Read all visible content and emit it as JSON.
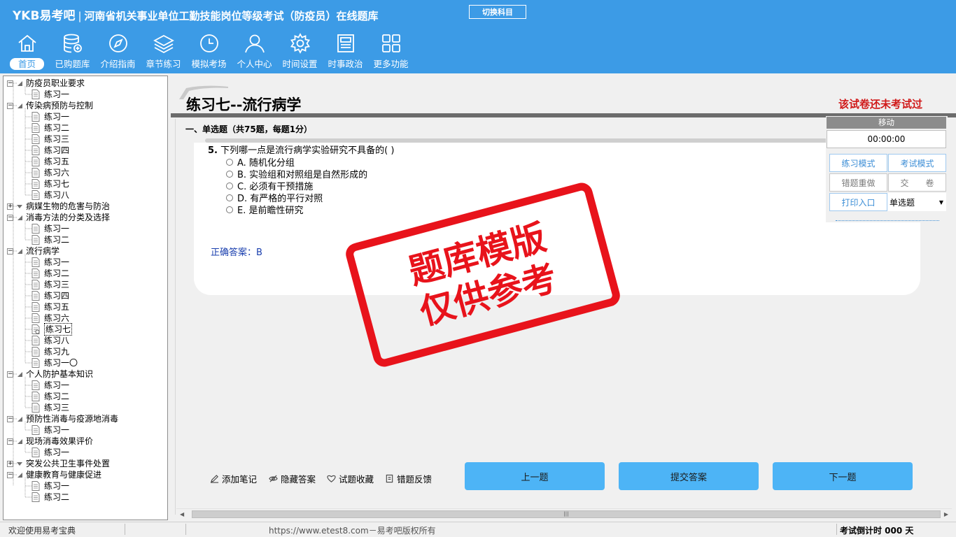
{
  "header": {
    "logo": "YKB易考吧",
    "separator": "|",
    "title": "河南省机关事业单位工勤技能岗位等级考试（防疫员）在线题库",
    "switch_label": "切换科目"
  },
  "nav": [
    {
      "label": "首页",
      "icon": "home-icon"
    },
    {
      "label": "已购题库",
      "icon": "database-icon"
    },
    {
      "label": "介绍指南",
      "icon": "compass-icon"
    },
    {
      "label": "章节练习",
      "icon": "layers-icon"
    },
    {
      "label": "模拟考场",
      "icon": "clock-icon"
    },
    {
      "label": "个人中心",
      "icon": "user-icon"
    },
    {
      "label": "时间设置",
      "icon": "gear-icon"
    },
    {
      "label": "时事政治",
      "icon": "news-icon"
    },
    {
      "label": "更多功能",
      "icon": "grid-icon"
    }
  ],
  "tree": [
    {
      "label": "防疫员职业要求",
      "level": 0,
      "expanded": true
    },
    {
      "label": "练习一",
      "level": 1
    },
    {
      "label": "传染病预防与控制",
      "level": 0,
      "expanded": true
    },
    {
      "label": "练习一",
      "level": 1
    },
    {
      "label": "练习二",
      "level": 1
    },
    {
      "label": "练习三",
      "level": 1
    },
    {
      "label": "练习四",
      "level": 1
    },
    {
      "label": "练习五",
      "level": 1
    },
    {
      "label": "练习六",
      "level": 1
    },
    {
      "label": "练习七",
      "level": 1
    },
    {
      "label": "练习八",
      "level": 1
    },
    {
      "label": "病媒生物的危害与防治",
      "level": 0,
      "expanded": false
    },
    {
      "label": "消毒方法的分类及选择",
      "level": 0,
      "expanded": true
    },
    {
      "label": "练习一",
      "level": 1
    },
    {
      "label": "练习二",
      "level": 1
    },
    {
      "label": "流行病学",
      "level": 0,
      "expanded": true
    },
    {
      "label": "练习一",
      "level": 1
    },
    {
      "label": "练习二",
      "level": 1
    },
    {
      "label": "练习三",
      "level": 1
    },
    {
      "label": "练习四",
      "level": 1
    },
    {
      "label": "练习五",
      "level": 1
    },
    {
      "label": "练习六",
      "level": 1
    },
    {
      "label": "练习七",
      "level": 1,
      "selected": true
    },
    {
      "label": "练习八",
      "level": 1
    },
    {
      "label": "练习九",
      "level": 1
    },
    {
      "label": "练习一〇",
      "level": 1
    },
    {
      "label": "个人防护基本知识",
      "level": 0,
      "expanded": true
    },
    {
      "label": "练习一",
      "level": 1
    },
    {
      "label": "练习二",
      "level": 1
    },
    {
      "label": "练习三",
      "level": 1
    },
    {
      "label": "预防性消毒与疫源地消毒",
      "level": 0,
      "expanded": true
    },
    {
      "label": "练习一",
      "level": 1
    },
    {
      "label": "现场消毒效果评价",
      "level": 0,
      "expanded": true
    },
    {
      "label": "练习一",
      "level": 1
    },
    {
      "label": "突发公共卫生事件处置",
      "level": 0,
      "expanded": false
    },
    {
      "label": "健康教育与健康促进",
      "level": 0,
      "expanded": true
    },
    {
      "label": "练习一",
      "level": 1
    },
    {
      "label": "练习二",
      "level": 1
    }
  ],
  "main": {
    "title": "练习七--流行病学",
    "status": "该试卷还未考试过",
    "section": "一、单选题（共75题，每题1分）",
    "question": {
      "number": "5.",
      "text": "下列哪一点是流行病学实验研究不具备的( )",
      "options": [
        "A. 随机化分组",
        "B. 实验组和对照组是自然形成的",
        "C. 必须有干预措施",
        "D. 有严格的平行对照",
        "E. 是前瞻性研究"
      ],
      "answer": "正确答案：B"
    }
  },
  "panel": {
    "header": "移动",
    "timer": "00:00:00",
    "practice_mode": "练习模式",
    "exam_mode": "考试模式",
    "redo_wrong": "错题重做",
    "submit_paper": "交　　卷",
    "print": "打印入口",
    "question_type": "单选题"
  },
  "tools": {
    "add_note": "添加笔记",
    "hide_answer": "隐藏答案",
    "favorite": "试题收藏",
    "feedback": "错题反馈"
  },
  "buttons": {
    "prev": "上一题",
    "submit": "提交答案",
    "next": "下一题"
  },
  "stamp": {
    "line1": "题库模版",
    "line2": "仅供参考"
  },
  "statusbar": {
    "welcome": "欢迎使用易考宝典",
    "copyright": "https://www.etest8.com－易考吧版权所有",
    "countdown": "考试倒计时 000 天"
  },
  "colors": {
    "header_bg": "#3c9be6",
    "status_red": "#d01818",
    "stamp_red": "#e8131b",
    "button_blue": "#4db4f6",
    "answer_blue": "#1a3fae"
  }
}
